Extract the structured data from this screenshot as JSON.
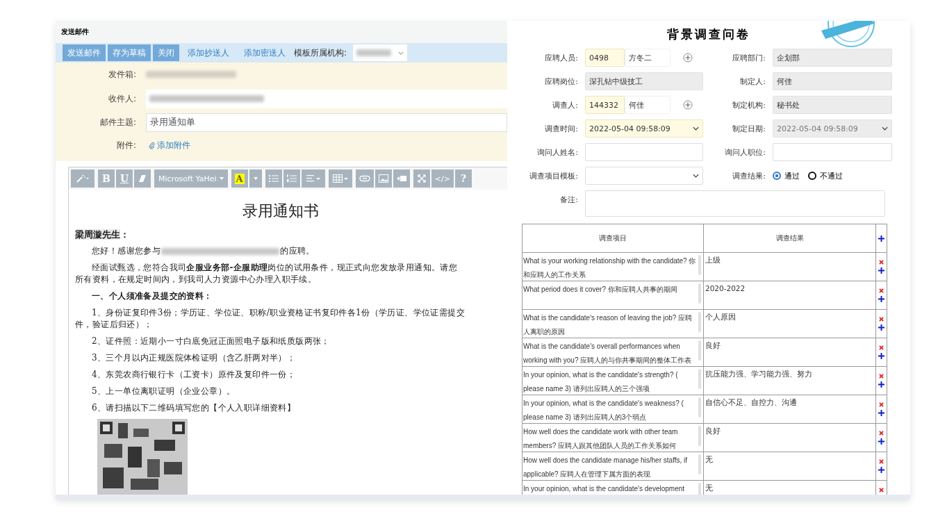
{
  "mail": {
    "title": "发送邮件",
    "actions": [
      {
        "label": "发送邮件",
        "kind": "button"
      },
      {
        "label": "存为草稿",
        "kind": "button"
      },
      {
        "label": "关闭",
        "kind": "button"
      },
      {
        "label": "添加抄送人",
        "kind": "link"
      },
      {
        "label": "添加密送人",
        "kind": "link"
      }
    ],
    "template_label": "模板所属机构:",
    "fields": [
      {
        "label": "发件箱:",
        "kind": "blurred"
      },
      {
        "label": "收件人:",
        "kind": "blurred-input"
      },
      {
        "label": "邮件主题:",
        "kind": "input",
        "value": "录用通知单"
      },
      {
        "label": "附件:",
        "kind": "attach",
        "value": "添加附件"
      }
    ]
  },
  "editor": {
    "font": "Microsoft YaHei",
    "bold": "B",
    "underline": "U",
    "color_key": "A",
    "code": "</>",
    "help": "?",
    "doc_title": "录用通知书",
    "greeting_name": "梁周漩先生",
    "greeting_suffix": "：",
    "paragraphs": [
      {
        "kind": "redacted",
        "before": "您好！感谢您参与",
        "after": "的应聘。"
      },
      {
        "kind": "text",
        "lines": [
          "经面试甄选，您符合我司**企服业务部-企服助理**岗位的试用条件，现正式向您发放录用通知。请您",
          "所有资料，在规定时间内，到我司人力资源中心办理入职手续。"
        ]
      },
      {
        "kind": "heading",
        "lines": [
          "一、个人须准备及提交的资料："
        ]
      },
      {
        "kind": "text",
        "lines": [
          "1、身份证复印件3份；学历证、学位证、职称/职业资格证书复印件各1份（学历证、学位证需提交",
          "件，验证后归还）；"
        ]
      },
      {
        "kind": "text",
        "lines": [
          "2、证件照：近期小一寸白底免冠正面照电子版和纸质版两张；"
        ]
      },
      {
        "kind": "text",
        "lines": [
          "3、三个月以内正规医院体检证明（含乙肝两对半）；"
        ]
      },
      {
        "kind": "text",
        "lines": [
          "4、东莞农商行银行卡（工资卡）原件及复印件一份；"
        ]
      },
      {
        "kind": "text",
        "lines": [
          "5、上一单位离职证明（企业公章）。"
        ]
      },
      {
        "kind": "text",
        "lines": [
          "6、请扫描以下二维码填写您的【个人入职详细资料】"
        ]
      },
      {
        "kind": "qr"
      }
    ]
  },
  "survey": {
    "title": "背景调查问卷",
    "fields": [
      {
        "label": "应聘人员:",
        "kind": "lookup",
        "code": "0498",
        "name": "方冬二"
      },
      {
        "label": "应聘部门:",
        "kind": "readonly",
        "value": "企划部"
      },
      {
        "label": "应聘岗位:",
        "kind": "readonly",
        "value": "深孔钻中级技工"
      },
      {
        "label": "制定人:",
        "kind": "readonly",
        "value": "何佳"
      },
      {
        "label": "调查人:",
        "kind": "lookup",
        "code": "144332",
        "name": "何佳"
      },
      {
        "label": "制定机构:",
        "kind": "readonly",
        "value": "秘书处"
      },
      {
        "label": "调查时间:",
        "kind": "select",
        "value": "2022-05-04 09:58:09",
        "required": true,
        "disabled": false
      },
      {
        "label": "制定日期:",
        "kind": "select",
        "value": "2022-05-04 09:58:09",
        "required": false,
        "disabled": true
      },
      {
        "label": "询问人姓名:",
        "kind": "input"
      },
      {
        "label": "询问人职位:",
        "kind": "input"
      },
      {
        "label": "调查项目模板:",
        "kind": "select",
        "required": false,
        "disabled": false
      },
      {
        "label": "调查结果:",
        "kind": "radio",
        "options": [
          {
            "label": "通过",
            "selected": true
          },
          {
            "label": "不通过",
            "selected": false
          }
        ]
      },
      {
        "label": "备注:",
        "kind": "textarea"
      }
    ],
    "columns": [
      "调查项目",
      "调查结果"
    ],
    "rows": [
      {
        "question": "What is your working relationship with the candidate? 你和应聘人的工作关系",
        "answer": "上级"
      },
      {
        "question": "What period does it cover? 你和应聘人共事的期间",
        "answer": "2020-2022"
      },
      {
        "question": "What is the candidate's reason of leaving the job? 应聘人离职的原因",
        "answer": "个人原因"
      },
      {
        "question": "What is the candidate's overall performances when working with you? 应聘人的与你共事期间的整体工作表",
        "answer": "良好"
      },
      {
        "question": "In your opinion, what is the candidate's strength? ( please name 3) 请列出应聘人的三个强项",
        "answer": "抗压能力强、学习能力强、努力"
      },
      {
        "question": "In your opinion, what is the candidate's weakness? ( please name 3) 请列出应聘人的3个弱点",
        "answer": "自信心不足、自控力、沟通"
      },
      {
        "question": "How well does the candidate work with other team members? 应聘人跟其他团队人员的工作关系如何",
        "answer": "良好"
      },
      {
        "question": "How well does the candidate manage his/her staffs, if applicable? 应聘人在管理下属方面的表现",
        "answer": "无"
      },
      {
        "question": "In your opinion, what is the candidate's development",
        "answer": "无"
      }
    ]
  }
}
